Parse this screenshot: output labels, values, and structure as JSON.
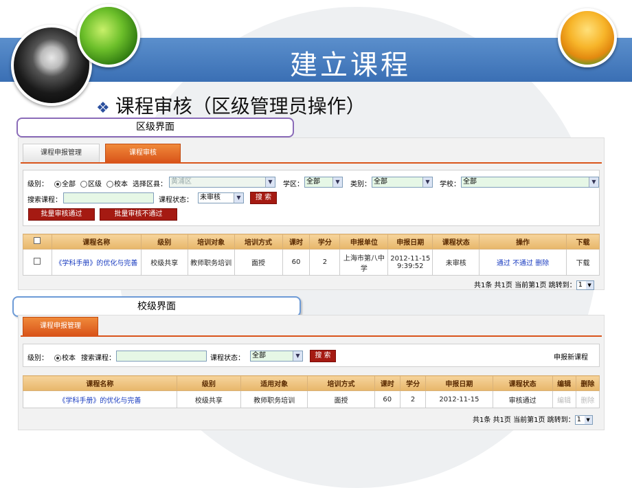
{
  "header": {
    "title": "建立课程",
    "subtitle": "课程审核（区级管理员操作）"
  },
  "district": {
    "label": "区级界面",
    "tabs": [
      "课程申报管理",
      "课程审核"
    ],
    "filters": {
      "level_label": "级别：",
      "level_options": [
        "全部",
        "区级",
        "校本"
      ],
      "county_label": "选择区县：",
      "county_value": "黄浦区",
      "district_label": "学区：",
      "district_value": "全部",
      "category_label": "类别：",
      "category_value": "全部",
      "school_label": "学校：",
      "school_value": "全部",
      "search_label": "搜索课程：",
      "status_label": "课程状态：",
      "status_value": "未审核",
      "search_button": "搜 索",
      "batch_pass": "批量审核通过",
      "batch_fail": "批量审核不通过"
    },
    "columns": [
      "课程名称",
      "级别",
      "培训对象",
      "培训方式",
      "课时",
      "学分",
      "申报单位",
      "申报日期",
      "课程状态",
      "操作",
      "下载"
    ],
    "rows": [
      {
        "name": "《学科手册》的优化与完善",
        "level": "校级共享",
        "target": "教师职务培训",
        "method": "面授",
        "hours": "60",
        "credits": "2",
        "unit": "上海市第八中学",
        "date": "2012-11-15 9:39:52",
        "status": "未审核",
        "op_pass": "通过",
        "op_fail": "不通过",
        "op_delete": "删除",
        "download": "下载"
      }
    ],
    "pager": {
      "text": "共1条 共1页 当前第1页 跳转到：",
      "page": "1"
    }
  },
  "school": {
    "label": "校级界面",
    "tabs": [
      "课程申报管理"
    ],
    "filters": {
      "level_label": "级别：",
      "level_option": "校本",
      "search_label": "搜索课程：",
      "status_label": "课程状态：",
      "status_value": "全部",
      "search_button": "搜 索",
      "new_link": "申报新课程"
    },
    "columns": [
      "课程名称",
      "级别",
      "适用对象",
      "培训方式",
      "课时",
      "学分",
      "申报日期",
      "课程状态",
      "编辑",
      "删除"
    ],
    "rows": [
      {
        "name": "《学科手册》的优化与完善",
        "level": "校级共享",
        "target": "教师职务培训",
        "method": "面授",
        "hours": "60",
        "credits": "2",
        "date": "2012-11-15",
        "status": "审核通过",
        "edit": "编辑",
        "delete": "删除"
      }
    ],
    "pager": {
      "text": "共1条 共1页 当前第1页 跳转到：",
      "page": "1"
    }
  }
}
